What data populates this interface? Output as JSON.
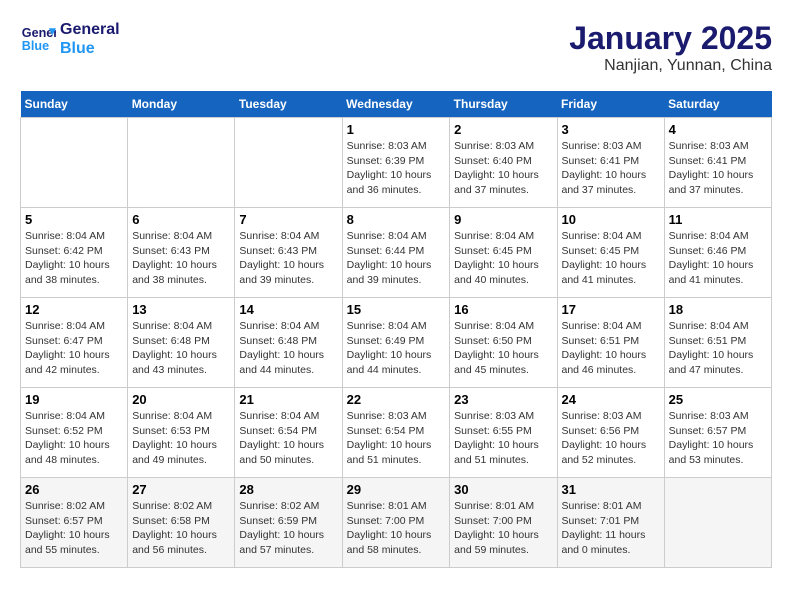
{
  "header": {
    "logo_line1": "General",
    "logo_line2": "Blue",
    "month_title": "January 2025",
    "location": "Nanjian, Yunnan, China"
  },
  "days_of_week": [
    "Sunday",
    "Monday",
    "Tuesday",
    "Wednesday",
    "Thursday",
    "Friday",
    "Saturday"
  ],
  "weeks": [
    [
      {
        "day": "",
        "info": ""
      },
      {
        "day": "",
        "info": ""
      },
      {
        "day": "",
        "info": ""
      },
      {
        "day": "1",
        "info": "Sunrise: 8:03 AM\nSunset: 6:39 PM\nDaylight: 10 hours\nand 36 minutes."
      },
      {
        "day": "2",
        "info": "Sunrise: 8:03 AM\nSunset: 6:40 PM\nDaylight: 10 hours\nand 37 minutes."
      },
      {
        "day": "3",
        "info": "Sunrise: 8:03 AM\nSunset: 6:41 PM\nDaylight: 10 hours\nand 37 minutes."
      },
      {
        "day": "4",
        "info": "Sunrise: 8:03 AM\nSunset: 6:41 PM\nDaylight: 10 hours\nand 37 minutes."
      }
    ],
    [
      {
        "day": "5",
        "info": "Sunrise: 8:04 AM\nSunset: 6:42 PM\nDaylight: 10 hours\nand 38 minutes."
      },
      {
        "day": "6",
        "info": "Sunrise: 8:04 AM\nSunset: 6:43 PM\nDaylight: 10 hours\nand 38 minutes."
      },
      {
        "day": "7",
        "info": "Sunrise: 8:04 AM\nSunset: 6:43 PM\nDaylight: 10 hours\nand 39 minutes."
      },
      {
        "day": "8",
        "info": "Sunrise: 8:04 AM\nSunset: 6:44 PM\nDaylight: 10 hours\nand 39 minutes."
      },
      {
        "day": "9",
        "info": "Sunrise: 8:04 AM\nSunset: 6:45 PM\nDaylight: 10 hours\nand 40 minutes."
      },
      {
        "day": "10",
        "info": "Sunrise: 8:04 AM\nSunset: 6:45 PM\nDaylight: 10 hours\nand 41 minutes."
      },
      {
        "day": "11",
        "info": "Sunrise: 8:04 AM\nSunset: 6:46 PM\nDaylight: 10 hours\nand 41 minutes."
      }
    ],
    [
      {
        "day": "12",
        "info": "Sunrise: 8:04 AM\nSunset: 6:47 PM\nDaylight: 10 hours\nand 42 minutes."
      },
      {
        "day": "13",
        "info": "Sunrise: 8:04 AM\nSunset: 6:48 PM\nDaylight: 10 hours\nand 43 minutes."
      },
      {
        "day": "14",
        "info": "Sunrise: 8:04 AM\nSunset: 6:48 PM\nDaylight: 10 hours\nand 44 minutes."
      },
      {
        "day": "15",
        "info": "Sunrise: 8:04 AM\nSunset: 6:49 PM\nDaylight: 10 hours\nand 44 minutes."
      },
      {
        "day": "16",
        "info": "Sunrise: 8:04 AM\nSunset: 6:50 PM\nDaylight: 10 hours\nand 45 minutes."
      },
      {
        "day": "17",
        "info": "Sunrise: 8:04 AM\nSunset: 6:51 PM\nDaylight: 10 hours\nand 46 minutes."
      },
      {
        "day": "18",
        "info": "Sunrise: 8:04 AM\nSunset: 6:51 PM\nDaylight: 10 hours\nand 47 minutes."
      }
    ],
    [
      {
        "day": "19",
        "info": "Sunrise: 8:04 AM\nSunset: 6:52 PM\nDaylight: 10 hours\nand 48 minutes."
      },
      {
        "day": "20",
        "info": "Sunrise: 8:04 AM\nSunset: 6:53 PM\nDaylight: 10 hours\nand 49 minutes."
      },
      {
        "day": "21",
        "info": "Sunrise: 8:04 AM\nSunset: 6:54 PM\nDaylight: 10 hours\nand 50 minutes."
      },
      {
        "day": "22",
        "info": "Sunrise: 8:03 AM\nSunset: 6:54 PM\nDaylight: 10 hours\nand 51 minutes."
      },
      {
        "day": "23",
        "info": "Sunrise: 8:03 AM\nSunset: 6:55 PM\nDaylight: 10 hours\nand 51 minutes."
      },
      {
        "day": "24",
        "info": "Sunrise: 8:03 AM\nSunset: 6:56 PM\nDaylight: 10 hours\nand 52 minutes."
      },
      {
        "day": "25",
        "info": "Sunrise: 8:03 AM\nSunset: 6:57 PM\nDaylight: 10 hours\nand 53 minutes."
      }
    ],
    [
      {
        "day": "26",
        "info": "Sunrise: 8:02 AM\nSunset: 6:57 PM\nDaylight: 10 hours\nand 55 minutes."
      },
      {
        "day": "27",
        "info": "Sunrise: 8:02 AM\nSunset: 6:58 PM\nDaylight: 10 hours\nand 56 minutes."
      },
      {
        "day": "28",
        "info": "Sunrise: 8:02 AM\nSunset: 6:59 PM\nDaylight: 10 hours\nand 57 minutes."
      },
      {
        "day": "29",
        "info": "Sunrise: 8:01 AM\nSunset: 7:00 PM\nDaylight: 10 hours\nand 58 minutes."
      },
      {
        "day": "30",
        "info": "Sunrise: 8:01 AM\nSunset: 7:00 PM\nDaylight: 10 hours\nand 59 minutes."
      },
      {
        "day": "31",
        "info": "Sunrise: 8:01 AM\nSunset: 7:01 PM\nDaylight: 11 hours\nand 0 minutes."
      },
      {
        "day": "",
        "info": ""
      }
    ]
  ]
}
